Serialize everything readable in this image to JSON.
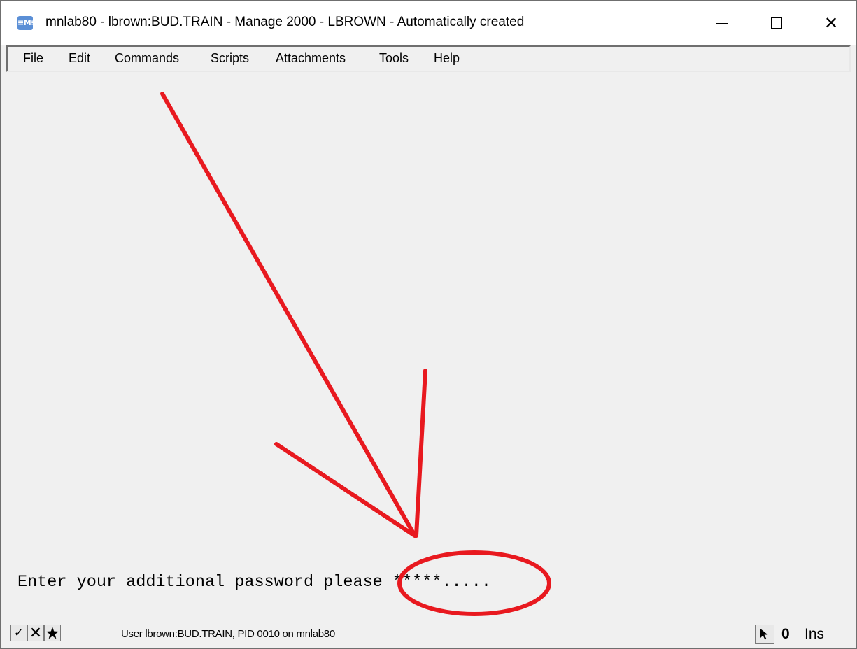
{
  "window": {
    "icon_text": "≡M≡",
    "title": "mnlab80 - lbrown:BUD.TRAIN - Manage 2000 - LBROWN - Automatically created",
    "controls": {
      "minimize_icon": "minimize-icon",
      "maximize_icon": "maximize-icon",
      "close_symbol": "✕"
    }
  },
  "menu": {
    "items": [
      "File",
      "Edit",
      "Commands",
      "Scripts",
      "Attachments",
      "Tools",
      "Help"
    ]
  },
  "terminal": {
    "prompt": "Enter your additional password please ",
    "masked_input": "*****",
    "remaining_placeholder": ".....",
    "annotation_color": "#e8191f"
  },
  "statusbar": {
    "check_symbol": "✓",
    "x_symbol": "✕",
    "star_icon": "star-icon",
    "status_text": "User lbrown:BUD.TRAIN, PID 0010 on mnlab80",
    "pointer_icon": "pointer-arrow-icon",
    "cursor_count": "0",
    "mode": "Ins"
  }
}
